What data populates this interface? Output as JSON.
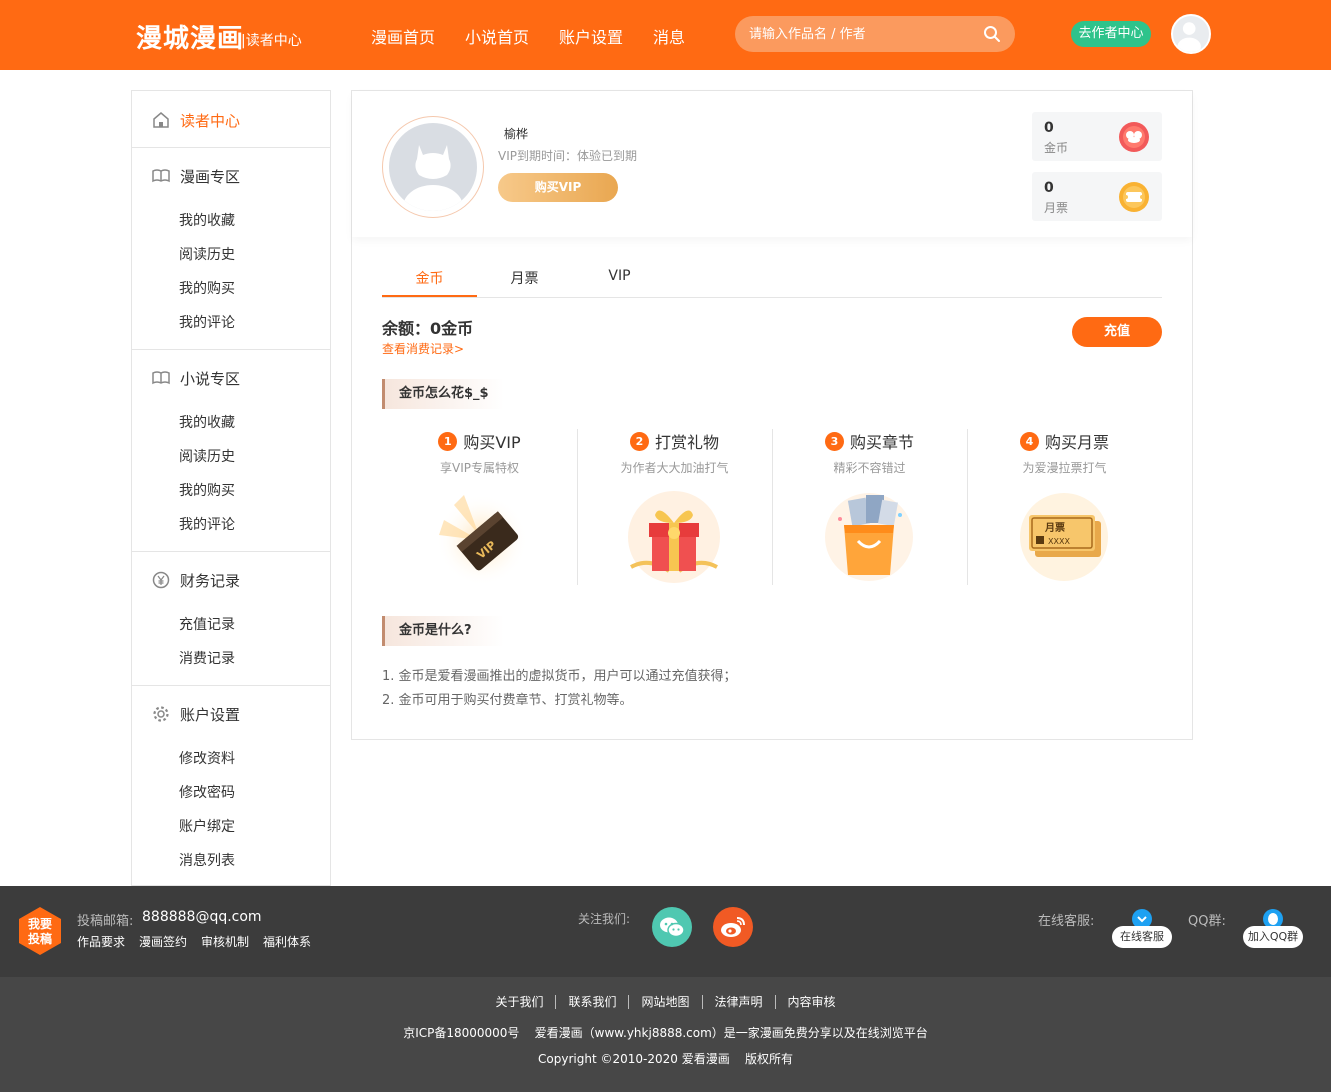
{
  "header": {
    "logo": "漫城漫画",
    "logo_sub": "|读者中心",
    "nav": [
      "漫画首页",
      "小说首页",
      "账户设置",
      "消息"
    ],
    "search_placeholder": "请输入作品名 / 作者",
    "author_button": "去作者中心",
    "colors": {
      "brand": "#ff6a13",
      "author": "#2ec38b"
    }
  },
  "sidebar": {
    "reader_center": "读者中心",
    "sections": [
      {
        "title": "漫画专区",
        "icon": "book-icon",
        "items": [
          "我的收藏",
          "阅读历史",
          "我的购买",
          "我的评论"
        ]
      },
      {
        "title": "小说专区",
        "icon": "book-icon",
        "items": [
          "我的收藏",
          "阅读历史",
          "我的购买",
          "我的评论"
        ]
      },
      {
        "title": "财务记录",
        "icon": "yen-icon",
        "items": [
          "充值记录",
          "消费记录"
        ]
      },
      {
        "title": "账户设置",
        "icon": "gear-icon",
        "items": [
          "修改资料",
          "修改密码",
          "账户绑定",
          "消息列表"
        ]
      }
    ]
  },
  "profile": {
    "username": "榆桦",
    "vip_expiry": "VIP到期时间：体验已到期",
    "buy_vip": "购买VIP",
    "stats": [
      {
        "value": "0",
        "label": "金币",
        "icon": "coin-icon"
      },
      {
        "value": "0",
        "label": "月票",
        "icon": "ticket-icon"
      }
    ]
  },
  "tabs": [
    "金币",
    "月票",
    "VIP"
  ],
  "balance": {
    "text": "余额：0金币",
    "records_link": "查看消费记录>",
    "recharge": "充值"
  },
  "spend": {
    "title": "金币怎么花$_$",
    "features": [
      {
        "num": "1",
        "title": "购买VIP",
        "desc": "享VIP专属特权",
        "icon": "vip-card-icon"
      },
      {
        "num": "2",
        "title": "打赏礼物",
        "desc": "为作者大大加油打气",
        "icon": "gift-box-icon"
      },
      {
        "num": "3",
        "title": "购买章节",
        "desc": "精彩不容错过",
        "icon": "shopping-bag-icon"
      },
      {
        "num": "4",
        "title": "购买月票",
        "desc": "为爱漫拉票打气",
        "icon": "monthly-ticket-icon",
        "ticket_title": "月票",
        "ticket_code": "XXXX"
      }
    ]
  },
  "faq": {
    "title": "金币是什么?",
    "lines": [
      "1. 金币是爱看漫画推出的虚拟货币，用户可以通过充值获得；",
      "2. 金币可用于购买付费章节、打赏礼物等。"
    ]
  },
  "footer": {
    "submit_badge": [
      "我要",
      "投稿"
    ],
    "email_label": "投稿邮箱:",
    "email": "888888@qq.com",
    "links": [
      "作品要求",
      "漫画签约",
      "审核机制",
      "福利体系"
    ],
    "follow": "关注我们:",
    "service_label": "在线客服:",
    "service_btn": "在线客服",
    "qq_label": "QQ群:",
    "qq_btn": "加入QQ群",
    "bottom_links": [
      "关于我们",
      "联系我们",
      "网站地图",
      "法律声明",
      "内容审核"
    ],
    "icp": "京ICP备18000000号    爱看漫画（www.yhkj8888.com）是一家漫画免费分享以及在线浏览平台",
    "copyright": "Copyright ©2010-2020 爱看漫画    版权所有"
  }
}
